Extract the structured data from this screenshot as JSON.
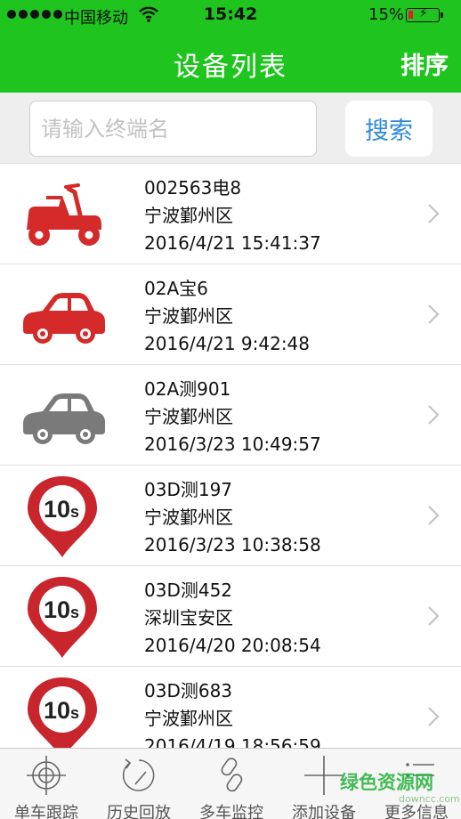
{
  "status_bar": {
    "carrier": "中国移动",
    "time": "15:42",
    "battery_percent": "15%",
    "battery_level": 0.15,
    "signal_bars": 5,
    "wifi_icon": "wifi-icon"
  },
  "nav": {
    "title": "设备列表",
    "sort_label": "排序"
  },
  "search": {
    "placeholder": "请输入终端名",
    "value": "",
    "button_label": "搜索"
  },
  "devices": [
    {
      "name": "002563电8",
      "region": "宁波鄞州区",
      "time": "2016/4/21 15:41:37",
      "icon": "scooter-icon",
      "color": "#d42a2a"
    },
    {
      "name": "02A宝6",
      "region": "宁波鄞州区",
      "time": "2016/4/21 9:42:48",
      "icon": "car-icon",
      "color": "#d42a2a"
    },
    {
      "name": "02A测901",
      "region": "宁波鄞州区",
      "time": "2016/3/23 10:49:57",
      "icon": "car-icon",
      "color": "#7a7a7a"
    },
    {
      "name": "03D测197",
      "region": "宁波鄞州区",
      "time": "2016/3/23 10:38:58",
      "icon": "map-pin-10s-icon",
      "color": "#c8262c",
      "pin_label": "10s"
    },
    {
      "name": "03D测452",
      "region": "深圳宝安区",
      "time": "2016/4/20 20:08:54",
      "icon": "map-pin-10s-icon",
      "color": "#c8262c",
      "pin_label": "10s"
    },
    {
      "name": "03D测683",
      "region": "宁波鄞州区",
      "time": "2016/4/19 18:56:59",
      "icon": "map-pin-10s-icon",
      "color": "#c8262c",
      "pin_label": "10s"
    }
  ],
  "tabs": [
    {
      "label": "单车跟踪",
      "icon": "crosshair-icon"
    },
    {
      "label": "历史回放",
      "icon": "history-icon"
    },
    {
      "label": "多车监控",
      "icon": "link-icon"
    },
    {
      "label": "添加设备",
      "icon": "plus-icon"
    },
    {
      "label": "更多信息",
      "icon": "list-icon"
    }
  ],
  "watermark": {
    "text": "绿色资源网",
    "url": "downcc.com"
  },
  "colors": {
    "accent": "#1fc41f",
    "link": "#2d8ad8"
  }
}
